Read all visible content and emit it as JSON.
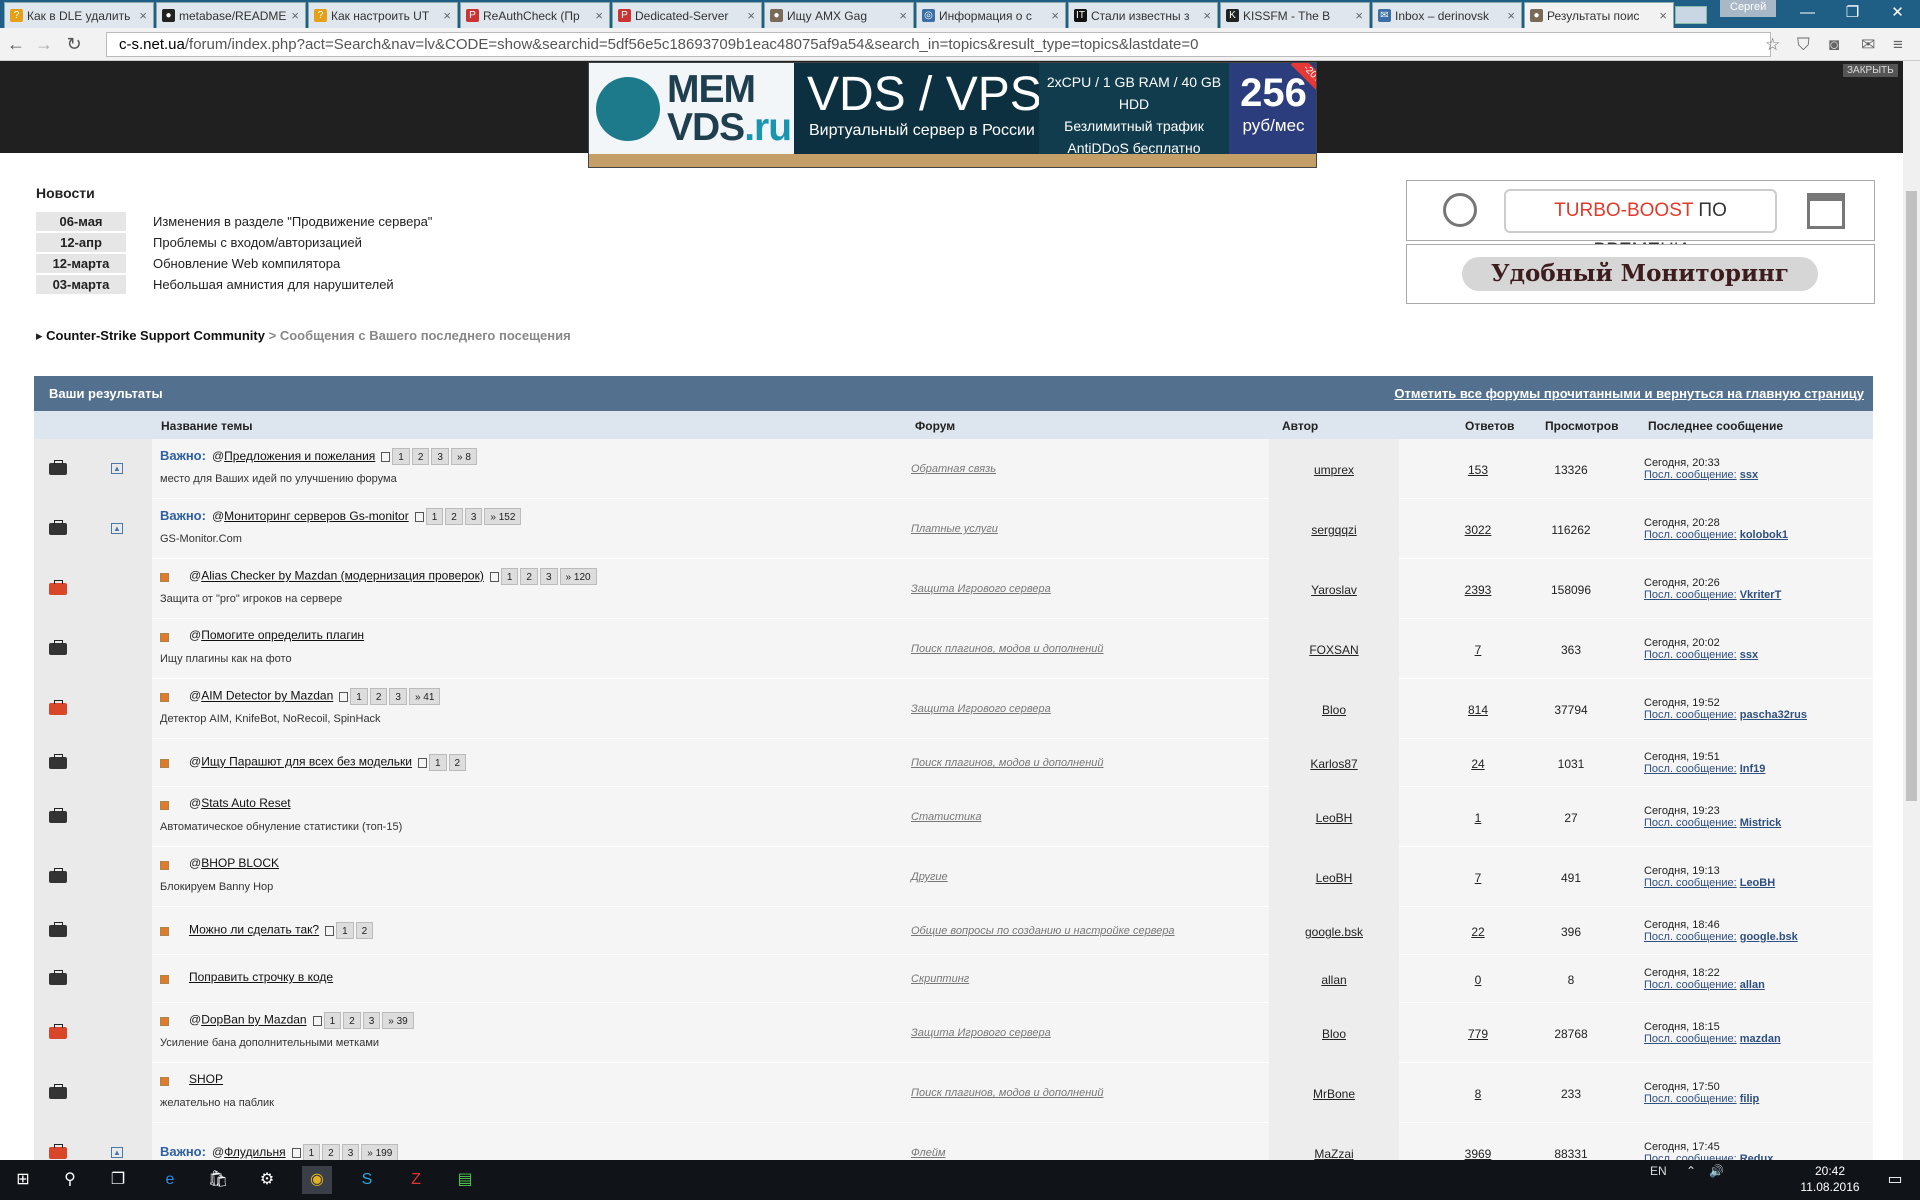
{
  "browser": {
    "tabs": [
      {
        "label": "Как в DLE удалить",
        "fav_color": "#e6a017",
        "fav_glyph": "?"
      },
      {
        "label": "metabase/README",
        "fav_color": "#222",
        "fav_glyph": "●"
      },
      {
        "label": "Как настроить UT",
        "fav_color": "#e6a017",
        "fav_glyph": "?"
      },
      {
        "label": "ReAuthCheck (Пр",
        "fav_color": "#c33",
        "fav_glyph": "Р"
      },
      {
        "label": "Dedicated-Server",
        "fav_color": "#c33",
        "fav_glyph": "Р"
      },
      {
        "label": "Ищу AMX Gag",
        "fav_color": "#7a6a58",
        "fav_glyph": "●"
      },
      {
        "label": "Информация о с",
        "fav_color": "#3a6ea5",
        "fav_glyph": "◎"
      },
      {
        "label": "Стали известны з",
        "fav_color": "#111",
        "fav_glyph": "IT"
      },
      {
        "label": "KISSFM - The B",
        "fav_color": "#222",
        "fav_glyph": "K"
      },
      {
        "label": "Inbox – derinovsk",
        "fav_color": "#3a6ea5",
        "fav_glyph": "✉"
      },
      {
        "label": "Результаты поис",
        "fav_color": "#7a6a58",
        "fav_glyph": "●"
      }
    ],
    "profile_name": "Сергей",
    "url_domain": "c-s.net.ua",
    "url_rest": "/forum/index.php?act=Search&nav=lv&CODE=show&searchid=5df56e5c18693709b1eac48075af9a54&search_in=topics&result_type=topics&lastdate=0"
  },
  "ad": {
    "close_label": "ЗАКРЫТЬ",
    "logo_mem": "MEM",
    "logo_vds": "VDS",
    "logo_ru": ".ru",
    "title": "VDS / VPS",
    "subtitle": "Виртуальный сервер в России",
    "spec_line1": "2xCPU / 1 GB RAM / 40 GB HDD",
    "spec_line2": "Безлимитный трафик",
    "spec_line3": "AntiDDoS бесплатно",
    "price": "256",
    "price_unit": "руб/мес",
    "discount": "-20%"
  },
  "news": {
    "title": "Новости",
    "items": [
      {
        "date": "06-мая",
        "text": "Изменения в разделе \"Продвижение сервера\""
      },
      {
        "date": "12-апр",
        "text": "Проблемы с входом/авторизацией"
      },
      {
        "date": "12-марта",
        "text": "Обновление Web компилятора"
      },
      {
        "date": "03-марта",
        "text": "Небольшая амнистия для нарушителей"
      }
    ]
  },
  "promo": {
    "turbo_a": "TURBO-BOOST",
    "turbo_b": "ПО ВРЕМЕНИ",
    "monitor": "Удобный Мониторинг"
  },
  "breadcrumb": {
    "root": "Counter-Strike Support Community",
    "sep": ">",
    "current": "Сообщения с Вашего последнего посещения"
  },
  "results": {
    "header_title": "Ваши результаты",
    "mark_read": "Отметить все форумы прочитанными и вернуться на главную страницу",
    "columns": {
      "topic": "Название темы",
      "forum": "Форум",
      "author": "Автор",
      "replies": "Ответов",
      "views": "Просмотров",
      "last": "Последнее сообщение"
    },
    "important_label": "Важно:",
    "last_label": "Посл. сообщение:",
    "rows": [
      {
        "pinned": true,
        "important": true,
        "hot": false,
        "prefix": "@",
        "title": "Предложения и пожелания",
        "pages": [
          "1",
          "2",
          "3",
          "» 8"
        ],
        "desc": "место для Ваших идей по улучшению форума",
        "forum": "Обратная связь",
        "author": "umprex",
        "replies": "153",
        "views": "13326",
        "time": "Сегодня, 20:33",
        "last_user": "ssx"
      },
      {
        "pinned": true,
        "important": true,
        "hot": false,
        "prefix": "@",
        "title": "Мониторинг серверов Gs-monitor",
        "pages": [
          "1",
          "2",
          "3",
          "» 152"
        ],
        "desc": "GS-Monitor.Com",
        "forum": "Платные услуги",
        "author": "sergqqzi",
        "replies": "3022",
        "views": "116262",
        "time": "Сегодня, 20:28",
        "last_user": "kolobok1"
      },
      {
        "pinned": false,
        "important": false,
        "hot": true,
        "prefix": "@",
        "title": "Alias Checker by Mazdan (модернизация проверок)",
        "pages": [
          "1",
          "2",
          "3",
          "» 120"
        ],
        "desc": "Защита от \"pro\" игроков на сервере",
        "forum": "Защита Игрового сервера",
        "author": "Yaroslav",
        "replies": "2393",
        "views": "158096",
        "time": "Сегодня, 20:26",
        "last_user": "VkriterT"
      },
      {
        "pinned": false,
        "important": false,
        "hot": false,
        "prefix": "@",
        "title": "Помогите определить плагин",
        "pages": [],
        "desc": "Ищу плагины как на фото",
        "forum": "Поиск плагинов, модов и дополнений",
        "author": "FOXSAN",
        "replies": "7",
        "views": "363",
        "time": "Сегодня, 20:02",
        "last_user": "ssx"
      },
      {
        "pinned": false,
        "important": false,
        "hot": true,
        "prefix": "@",
        "title": "AIM Detector by Mazdan",
        "pages": [
          "1",
          "2",
          "3",
          "» 41"
        ],
        "desc": "Детектор AIM, KnifeBot, NoRecoil, SpinHack",
        "forum": "Защита Игрового сервера",
        "author": "Bloo",
        "replies": "814",
        "views": "37794",
        "time": "Сегодня, 19:52",
        "last_user": "pascha32rus"
      },
      {
        "pinned": false,
        "important": false,
        "hot": false,
        "prefix": "@",
        "title": "Ищу Парашют для всех без модельки",
        "pages": [
          "1",
          "2"
        ],
        "desc": "",
        "forum": "Поиск плагинов, модов и дополнений",
        "author": "Karlos87",
        "replies": "24",
        "views": "1031",
        "time": "Сегодня, 19:51",
        "last_user": "Inf19"
      },
      {
        "pinned": false,
        "important": false,
        "hot": false,
        "prefix": "@",
        "title": "Stats Auto Reset",
        "pages": [],
        "desc": "Автоматическое обнуление статистики (топ-15)",
        "forum": "Статистика",
        "author": "LeoBH",
        "replies": "1",
        "views": "27",
        "time": "Сегодня, 19:23",
        "last_user": "Mistrick"
      },
      {
        "pinned": false,
        "important": false,
        "hot": false,
        "prefix": "@",
        "title": "BHOP BLOCK",
        "pages": [],
        "desc": "Блокируем Banny Hop",
        "forum": "Другие",
        "author": "LeoBH",
        "replies": "7",
        "views": "491",
        "time": "Сегодня, 19:13",
        "last_user": "LeoBH"
      },
      {
        "pinned": false,
        "important": false,
        "hot": false,
        "prefix": "",
        "title": "Можно ли сделать так?",
        "pages": [
          "1",
          "2"
        ],
        "desc": "",
        "forum": "Общие вопросы по созданию и настройке сервера",
        "author": "google.bsk",
        "replies": "22",
        "views": "396",
        "time": "Сегодня, 18:46",
        "last_user": "google.bsk"
      },
      {
        "pinned": false,
        "important": false,
        "hot": false,
        "prefix": "",
        "title": "Поправить строчку в коде",
        "pages": [],
        "desc": "",
        "forum": "Скриптинг",
        "author": "allan",
        "replies": "0",
        "views": "8",
        "time": "Сегодня, 18:22",
        "last_user": "allan"
      },
      {
        "pinned": false,
        "important": false,
        "hot": true,
        "prefix": "@",
        "title": "DopBan by Mazdan",
        "pages": [
          "1",
          "2",
          "3",
          "» 39"
        ],
        "desc": "Усиление бана дополнительными метками",
        "forum": "Защита Игрового сервера",
        "author": "Bloo",
        "replies": "779",
        "views": "28768",
        "time": "Сегодня, 18:15",
        "last_user": "mazdan"
      },
      {
        "pinned": false,
        "important": false,
        "hot": false,
        "prefix": "",
        "title": "SHOP",
        "pages": [],
        "desc": "желательно на паблик",
        "forum": "Поиск плагинов, модов и дополнений",
        "author": "MrBone",
        "replies": "8",
        "views": "233",
        "time": "Сегодня, 17:50",
        "last_user": "filip"
      },
      {
        "pinned": true,
        "important": true,
        "hot": true,
        "prefix": "@",
        "title": "Флудильня",
        "pages": [
          "1",
          "2",
          "3",
          "» 199"
        ],
        "desc": "",
        "forum": "Флейм",
        "author": "MaZzai",
        "replies": "3969",
        "views": "88331",
        "time": "Сегодня, 17:45",
        "last_user": "Redux"
      }
    ]
  },
  "taskbar": {
    "lang": "EN",
    "time": "20:42",
    "date": "11.08.2016"
  },
  "colors": {
    "header_bg": "#54708f",
    "folder_hot": "#d9472b",
    "folder_normal": "#333333"
  }
}
